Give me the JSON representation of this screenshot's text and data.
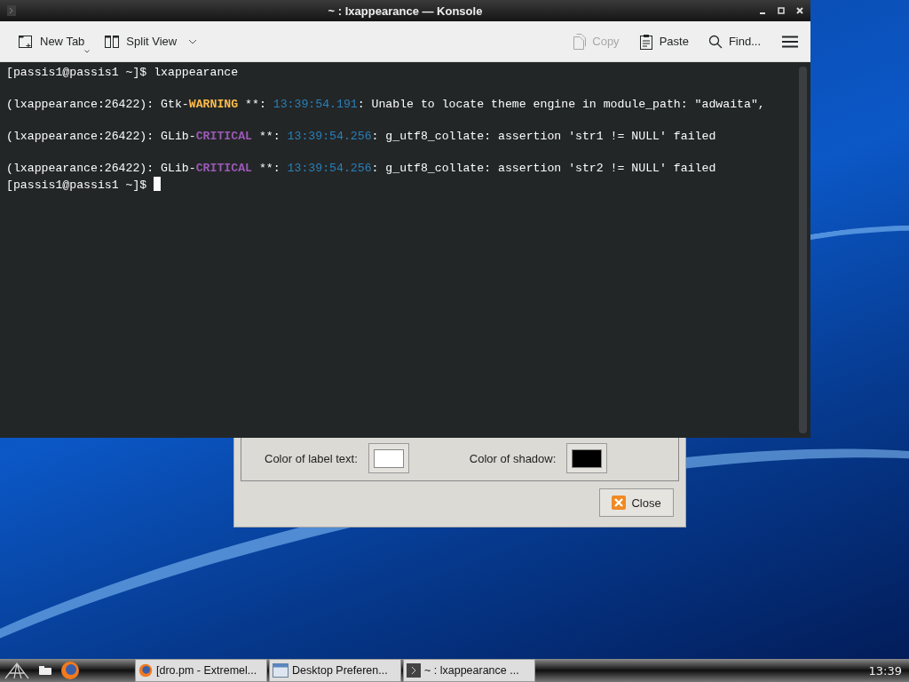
{
  "konsole": {
    "title": "~ : lxappearance — Konsole",
    "toolbar_left": [
      {
        "label": "New Tab",
        "kind": "new-tab"
      },
      {
        "label": "Split View",
        "kind": "split-view"
      }
    ],
    "toolbar_right": [
      {
        "label": "Copy",
        "kind": "copy",
        "disabled": true
      },
      {
        "label": "Paste",
        "kind": "paste",
        "disabled": false
      },
      {
        "label": "Find...",
        "kind": "find",
        "disabled": false
      }
    ],
    "lines": [
      {
        "blank_before": false,
        "segments": [
          {
            "text": "[passis1@passis1 ~]$ lxappearance",
            "kind": "plain"
          }
        ]
      },
      {
        "blank_before": true,
        "segments": [
          {
            "text": "(lxappearance:26422): Gtk-",
            "kind": "plain"
          },
          {
            "text": "WARNING",
            "kind": "warning"
          },
          {
            "text": " **: ",
            "kind": "plain"
          },
          {
            "text": "13:39:54.191",
            "kind": "time"
          },
          {
            "text": ": Unable to locate theme engine in module_path: \"adwaita\",",
            "kind": "plain"
          }
        ]
      },
      {
        "blank_before": true,
        "segments": [
          {
            "text": "(lxappearance:26422): GLib-",
            "kind": "plain"
          },
          {
            "text": "CRITICAL",
            "kind": "critical"
          },
          {
            "text": " **: ",
            "kind": "plain"
          },
          {
            "text": "13:39:54.256",
            "kind": "time"
          },
          {
            "text": ": g_utf8_collate: assertion 'str1 != NULL' failed",
            "kind": "plain"
          }
        ]
      },
      {
        "blank_before": true,
        "segments": [
          {
            "text": "(lxappearance:26422): GLib-",
            "kind": "plain"
          },
          {
            "text": "CRITICAL",
            "kind": "critical"
          },
          {
            "text": " **: ",
            "kind": "plain"
          },
          {
            "text": "13:39:54.256",
            "kind": "time"
          },
          {
            "text": ": g_utf8_collate: assertion 'str2 != NULL' failed",
            "kind": "plain"
          }
        ]
      },
      {
        "blank_before": false,
        "segments": [
          {
            "text": "[passis1@passis1 ~]$ ",
            "kind": "plain"
          }
        ],
        "cursor": true
      }
    ]
  },
  "dialog": {
    "color_fields": [
      {
        "label": "Color of label text:",
        "color": "#ffffff"
      },
      {
        "label": "Color of shadow:",
        "color": "#000000"
      }
    ],
    "close_button": "Close"
  },
  "taskbar": {
    "tasks": [
      {
        "label": "[dro.pm - Extremel...",
        "kind": "browser"
      },
      {
        "label": "Desktop Preferen...",
        "kind": "window"
      },
      {
        "label": "~ : lxappearance ...",
        "kind": "terminal"
      }
    ],
    "clock": "13:39"
  }
}
